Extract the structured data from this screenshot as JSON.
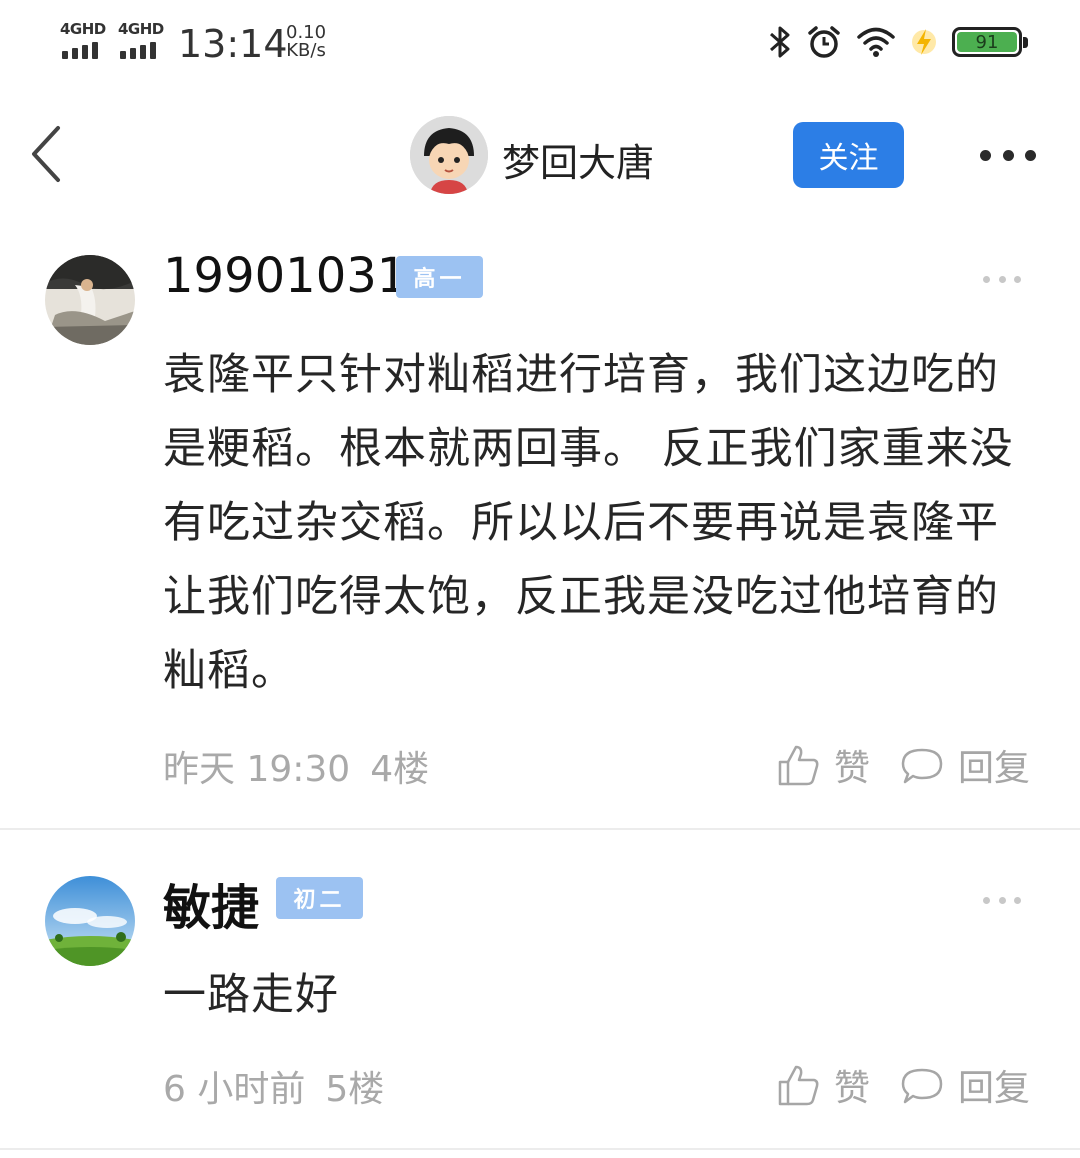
{
  "status_bar": {
    "signal_1_label": "4GHD",
    "signal_2_label": "4GHD",
    "time": "13:14",
    "net_speed_value": "0.10",
    "net_speed_unit": "KB/s",
    "battery_level": "91",
    "icons": [
      "bluetooth-icon",
      "alarm-icon",
      "wifi-icon",
      "charging-icon",
      "battery-icon"
    ]
  },
  "header": {
    "title": "梦回大唐",
    "follow_label": "关注"
  },
  "comments": [
    {
      "username": "19901031",
      "level": "高一",
      "text": "袁隆平只针对籼稻进行培育，我们这边吃的是粳稻。根本就两回事。 反正我们家重来没有吃过杂交稻。所以以后不要再说是袁隆平让我们吃得太饱，反正我是没吃过他培育的籼稻。",
      "time": "昨天 19:30",
      "floor": "4楼",
      "like_label": "赞",
      "reply_label": "回复"
    },
    {
      "username": "敏捷",
      "level": "初二",
      "text": "一路走好",
      "time": "6 小时前",
      "floor": "5楼",
      "like_label": "赞",
      "reply_label": "回复"
    }
  ],
  "colors": {
    "accent": "#2c7ee6",
    "level_badge": "#9cc2f2",
    "meta_text": "#a9a9a9",
    "battery": "#4caf50"
  }
}
